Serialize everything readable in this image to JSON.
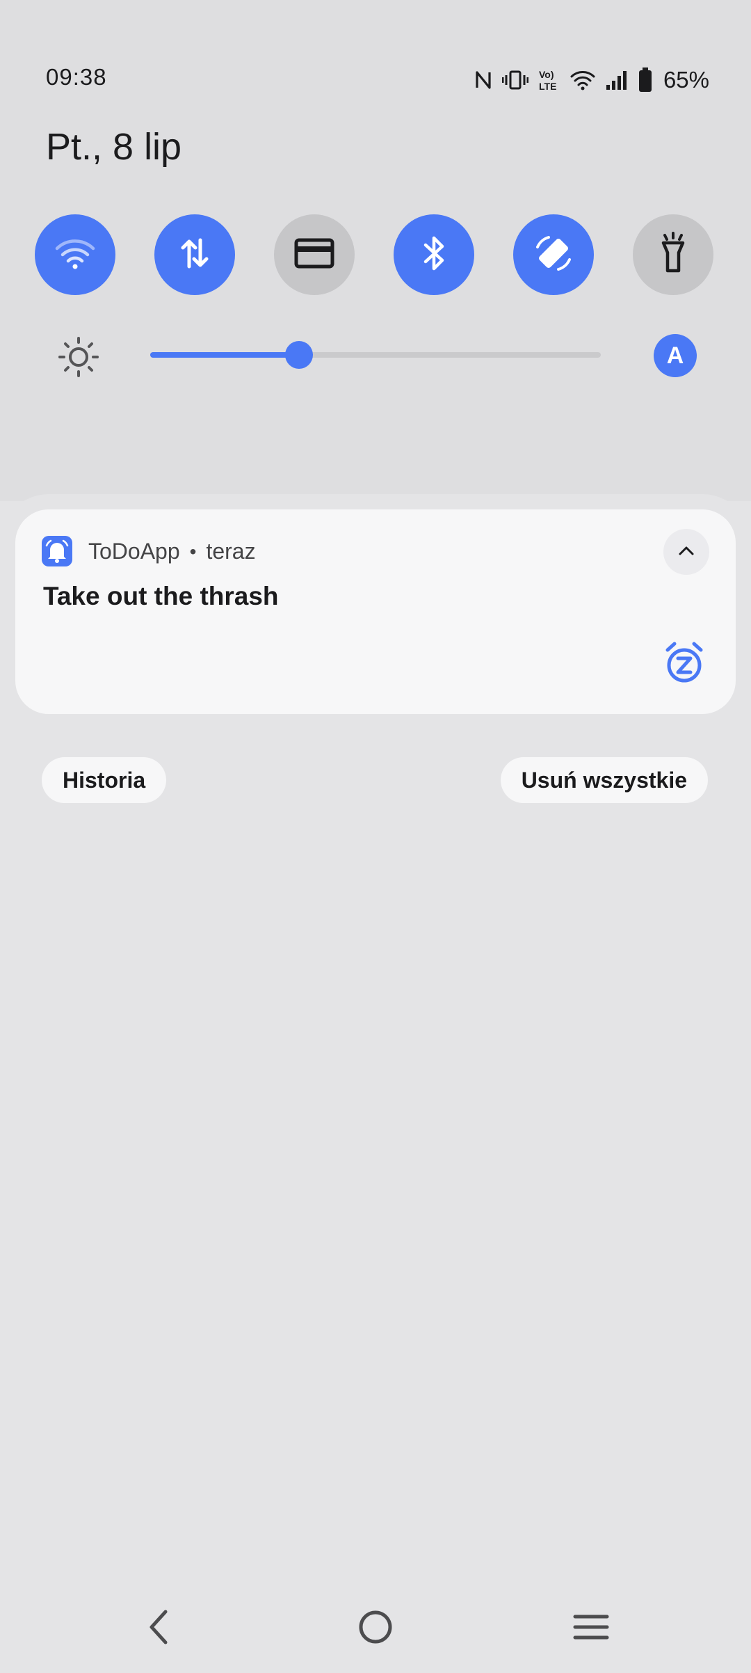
{
  "status_bar": {
    "time": "09:38",
    "battery_text": "65%",
    "icons": [
      "nfc-icon",
      "vibrate-icon",
      "volte-icon",
      "wifi-icon",
      "signal-icon",
      "battery-icon"
    ]
  },
  "header": {
    "date": "Pt., 8 lip"
  },
  "quick_settings": {
    "tiles": [
      {
        "icon": "wifi-icon",
        "active": true
      },
      {
        "icon": "mobile-data-icon",
        "active": true
      },
      {
        "icon": "card-icon",
        "active": false
      },
      {
        "icon": "bluetooth-icon",
        "active": true
      },
      {
        "icon": "auto-rotate-icon",
        "active": true
      },
      {
        "icon": "flashlight-icon",
        "active": false
      }
    ],
    "brightness": {
      "level": 0.33,
      "icon": "brightness-icon",
      "auto_label": "A"
    }
  },
  "notification": {
    "app_name": "ToDoApp",
    "separator": "•",
    "time": "teraz",
    "title": "Take out the thrash",
    "app_icon": "alarm-bell-icon",
    "action_icon": "snooze-icon"
  },
  "actions": {
    "history_label": "Historia",
    "clear_all_label": "Usuń wszystkie"
  },
  "nav": {
    "icons": [
      "back-icon",
      "home-icon",
      "recents-icon"
    ]
  },
  "colors": {
    "accent": "#4a78f5",
    "tile_off": "#c6c6c8",
    "shade_bg": "#dedee0",
    "panel_bg": "#e4e4e6",
    "card_bg": "#f7f7f8"
  }
}
